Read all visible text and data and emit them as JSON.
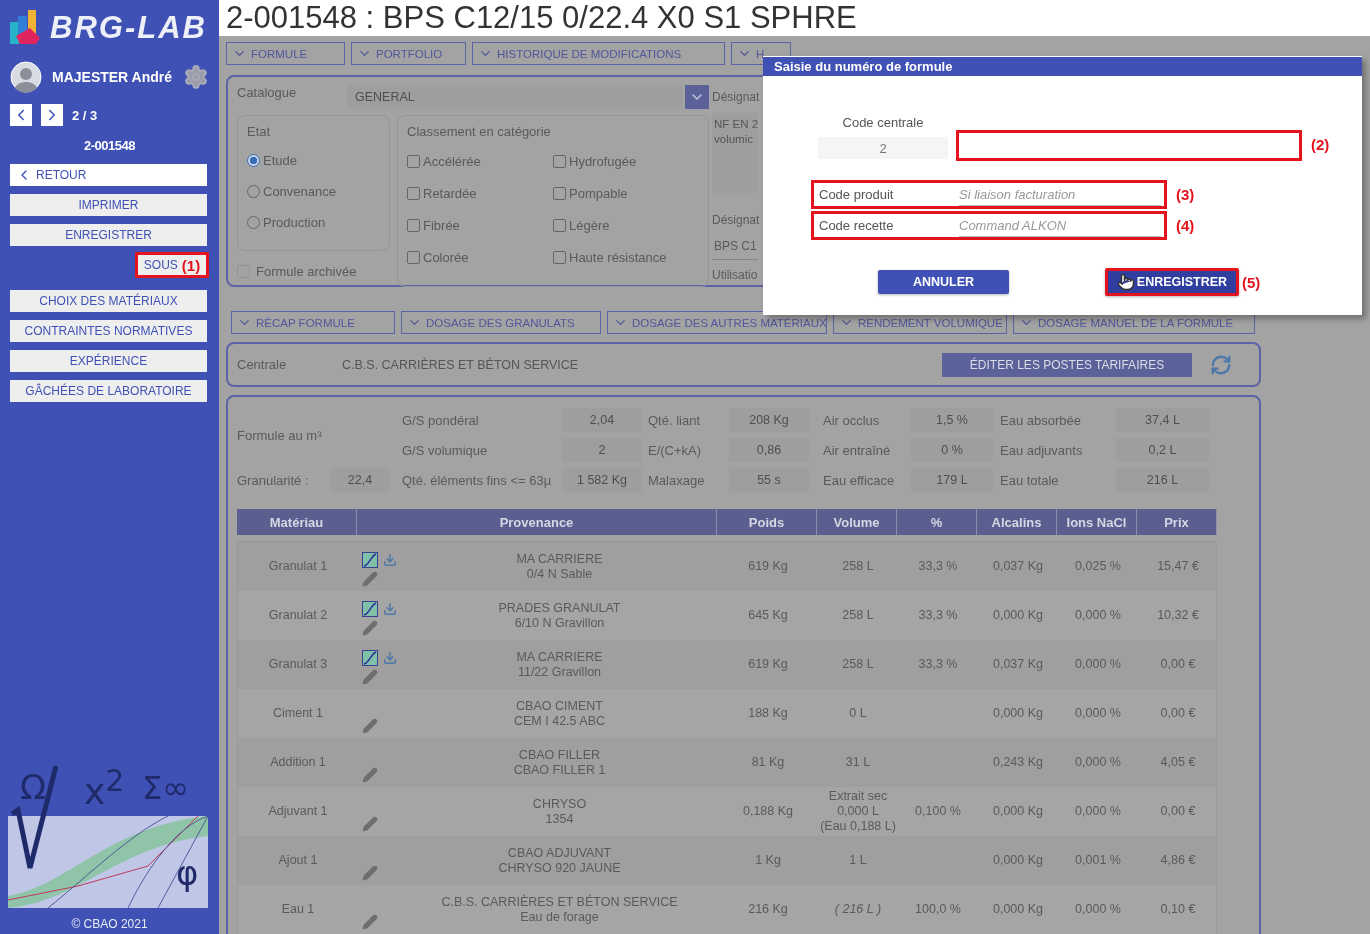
{
  "sidebar": {
    "logo": "BRG-LAB",
    "user": "MAJESTER André",
    "pager": "2 / 3",
    "record": "2-001548",
    "buttons": [
      {
        "kind": "back",
        "label": "RETOUR"
      },
      {
        "kind": "normal",
        "label": "IMPRIMER"
      },
      {
        "kind": "normal",
        "label": "ENREGISTRER"
      },
      {
        "kind": "small",
        "label": "SOUS",
        "callout": "(1)"
      },
      {
        "kind": "normal",
        "label": "CHOIX DES MATÉRIAUX"
      },
      {
        "kind": "normal",
        "label": "CONTRAINTES NORMATIVES"
      },
      {
        "kind": "normal",
        "label": "EXPÉRIENCE"
      },
      {
        "kind": "normal",
        "label": "GÂCHÉES DE LABORATOIRE"
      }
    ],
    "symbols": [
      "Ω",
      "x$^{2}$",
      "Σ∞",
      "φ"
    ],
    "footer": "© CBAO 2021"
  },
  "title": "2-001548 : BPS C12/15 0/22.4 X0 S1 SPHRE",
  "top_tabs": [
    "FORMULE",
    "PORTFOLIO",
    "HISTORIQUE DE MODIFICATIONS",
    "H"
  ],
  "general": {
    "catalogue": {
      "label": "Catalogue",
      "value": "GENERAL"
    },
    "etat": {
      "title": "Etat",
      "options": [
        {
          "label": "Etude",
          "selected": true
        },
        {
          "label": "Convenance",
          "selected": false
        },
        {
          "label": "Production",
          "selected": false
        }
      ]
    },
    "classement": {
      "title": "Classement en catégorie",
      "options": [
        {
          "label": "Accélérée",
          "checked": false
        },
        {
          "label": "Hydrofugée",
          "checked": false
        },
        {
          "label": "Retardée",
          "checked": false
        },
        {
          "label": "Pompable",
          "checked": false
        },
        {
          "label": "Fibrée",
          "checked": false
        },
        {
          "label": "Légère",
          "checked": false
        },
        {
          "label": "Colorée",
          "checked": false
        },
        {
          "label": "Haute résistance",
          "checked": false
        }
      ]
    },
    "archived": {
      "label": "Formule archivée",
      "checked": false
    },
    "designation": {
      "label_1": "Désignat",
      "note_lines": [
        "NF EN 2",
        "volumic"
      ],
      "label_2": "Désignat",
      "value": "BPS C1",
      "label_3": "Utilisatio"
    }
  },
  "section_tabs": [
    "RÉCAP FORMULE",
    "DOSAGE DES GRANULATS",
    "DOSAGE DES AUTRES MATÉRIAUX",
    "RENDEMENT VOLUMIQUE",
    "DOSAGE MANUEL DE LA FORMULE"
  ],
  "centrale": {
    "label": "Centrale",
    "value": "C.B.S. CARRIÈRES ET BÉTON SERVICE",
    "button": "ÉDITER LES POSTES TARIFAIRES"
  },
  "summary": {
    "title": "Formule au m³",
    "granularity": {
      "label": "Granularité :",
      "value": "22,4"
    },
    "rows": [
      [
        {
          "label": "G/S pondéral",
          "value": "2,04"
        },
        {
          "label": "Qté. liant",
          "value": "208 Kg"
        },
        {
          "label": "Air occlus",
          "value": "1,5 %"
        },
        {
          "label": "Eau absorbée",
          "value": "37,4 L"
        }
      ],
      [
        {
          "label": "G/S volumique",
          "value": "2"
        },
        {
          "label": "E/(C+kA)",
          "value": "0,86"
        },
        {
          "label": "Air entraîné",
          "value": "0 %"
        },
        {
          "label": "Eau adjuvants",
          "value": "0,2 L"
        }
      ],
      [
        {
          "label": "Qté. éléments fins <= 63µ",
          "value": "1 582 Kg"
        },
        {
          "label": "Malaxage",
          "value": "55 s"
        },
        {
          "label": "Eau efficace",
          "value": "179 L"
        },
        {
          "label": "Eau totale",
          "value": "216 L"
        }
      ]
    ]
  },
  "table": {
    "columns": [
      "Matériau",
      "Provenance",
      "Poids",
      "Volume",
      "%",
      "Alcalins",
      "Ions NaCl",
      "Prix"
    ],
    "rows": [
      {
        "material": "Granulat 1",
        "kind": "granulat",
        "provenance": [
          "MA CARRIERE",
          "0/4 N Sable"
        ],
        "poids": "619 Kg",
        "volume": [
          "258 L"
        ],
        "volume_italic": false,
        "percent": "33,3 %",
        "alcalins": "0,037 Kg",
        "ions": "0,025 %",
        "prix": "15,47 €"
      },
      {
        "material": "Granulat 2",
        "kind": "granulat",
        "provenance": [
          "PRADES GRANULAT",
          "6/10 N Gravillon"
        ],
        "poids": "645 Kg",
        "volume": [
          "258 L"
        ],
        "volume_italic": false,
        "percent": "33,3 %",
        "alcalins": "0,000 Kg",
        "ions": "0,000 %",
        "prix": "10,32 €"
      },
      {
        "material": "Granulat 3",
        "kind": "granulat",
        "provenance": [
          "MA CARRIERE",
          "11/22 Gravillon"
        ],
        "poids": "619 Kg",
        "volume": [
          "258 L"
        ],
        "volume_italic": false,
        "percent": "33,3 %",
        "alcalins": "0,037 Kg",
        "ions": "0,000 %",
        "prix": "0,00 €"
      },
      {
        "material": "Ciment 1",
        "kind": "other",
        "provenance": [
          "CBAO CIMENT",
          "CEM I 42.5 ABC"
        ],
        "poids": "188 Kg",
        "volume": [
          "0 L"
        ],
        "volume_italic": false,
        "alcalins": "0,000 Kg",
        "ions": "0,000 %",
        "prix": "0,00 €"
      },
      {
        "material": "Addition 1",
        "kind": "other",
        "provenance": [
          "CBAO FILLER",
          "CBAO FILLER 1"
        ],
        "poids": "81 Kg",
        "volume": [
          "31 L"
        ],
        "volume_italic": false,
        "alcalins": "0,243 Kg",
        "ions": "0,000 %",
        "prix": "4,05 €"
      },
      {
        "material": "Adjuvant 1",
        "kind": "other",
        "provenance": [
          "CHRYSO",
          "1354"
        ],
        "poids": "0,188 Kg",
        "volume": [
          "Extrait sec",
          "0,000 L",
          "(Eau 0,188 L)"
        ],
        "volume_italic": false,
        "percent": "0,100 %",
        "alcalins": "0,000 Kg",
        "ions": "0,000 %",
        "prix": "0,00 €"
      },
      {
        "material": "Ajout 1",
        "kind": "other",
        "provenance": [
          "CBAO ADJUVANT",
          "CHRYSO 920 JAUNE"
        ],
        "poids": "1 Kg",
        "volume": [
          "1 L"
        ],
        "volume_italic": false,
        "alcalins": "0,000 Kg",
        "ions": "0,001 %",
        "prix": "4,86 €"
      },
      {
        "material": "Eau 1",
        "kind": "other",
        "provenance": [
          "C.B.S. CARRIÈRES ET BÉTON SERVICE",
          "Eau de forage"
        ],
        "poids": "216 Kg",
        "volume": [
          "( 216 L )"
        ],
        "volume_italic": true,
        "percent": "100,0 %",
        "alcalins": "0,000 Kg",
        "ions": "0,000 %",
        "prix": "0,10 €"
      }
    ]
  },
  "dialog": {
    "title": "Saisie du numéro de formule",
    "code_centrale": {
      "label": "Code centrale",
      "value": "2"
    },
    "number_field": {
      "callout": "(2)"
    },
    "fields": [
      {
        "label": "Code produit",
        "placeholder": "Si liaison facturation",
        "callout": "(3)"
      },
      {
        "label": "Code recette",
        "placeholder": "Command ALKON",
        "callout": "(4)"
      }
    ],
    "buttons": [
      {
        "kind": "cancel",
        "label": "ANNULER"
      },
      {
        "kind": "save",
        "label": "ENREGISTRER",
        "callout": "(5)"
      }
    ]
  }
}
